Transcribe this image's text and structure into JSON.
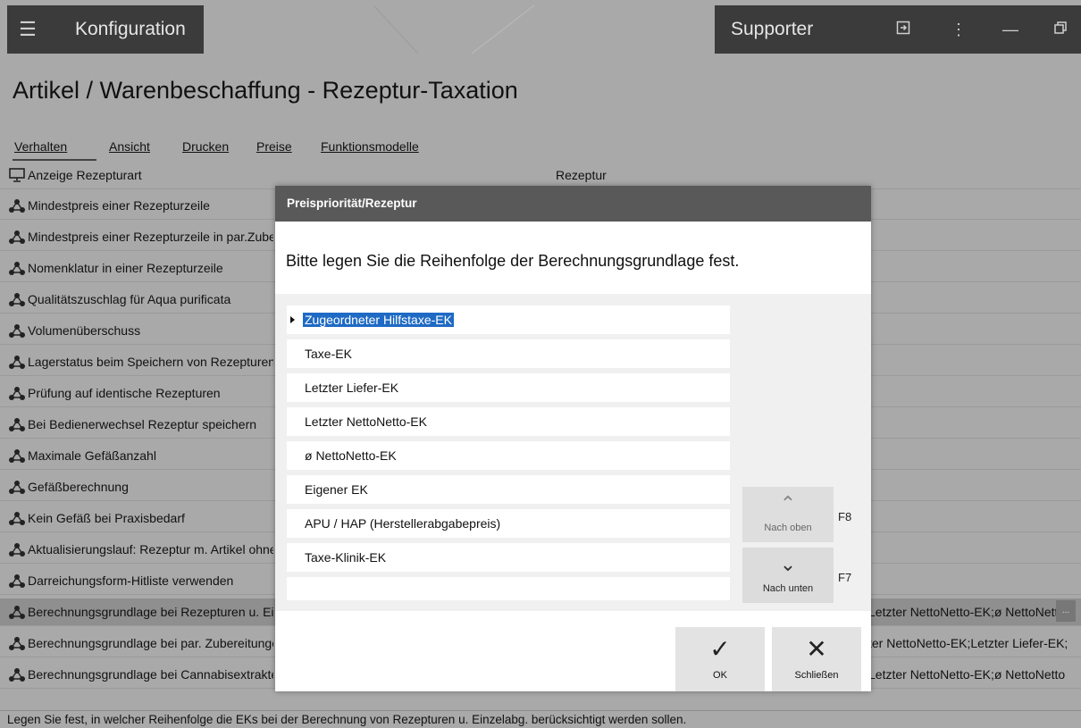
{
  "titlebar": {
    "app_title": "Konfiguration",
    "user": "Supporter",
    "icons": [
      "menu-icon",
      "logout-icon",
      "more-icon",
      "minimize-icon",
      "restore-icon"
    ]
  },
  "page_title": "Artikel / Warenbeschaffung - Rezeptur-Taxation",
  "tabs": [
    "Verhalten",
    "Ansicht",
    "Drucken",
    "Preise",
    "Funktionsmodelle"
  ],
  "rows": [
    {
      "label": "Anzeige Rezepturart",
      "value": "Rezeptur",
      "value_right": ""
    },
    {
      "label": "Mindestpreis einer Rezepturzeile",
      "value": "",
      "value_right": ""
    },
    {
      "label": "Mindestpreis einer Rezepturzeile in par.Zubereitungen",
      "value": "",
      "value_right": ""
    },
    {
      "label": "Nomenklatur in einer Rezepturzeile",
      "value": "",
      "value_right": ""
    },
    {
      "label": "Qualitätszuschlag für Aqua purificata",
      "value": "",
      "value_right": ""
    },
    {
      "label": "Volumenüberschuss",
      "value": "",
      "value_right": ""
    },
    {
      "label": "Lagerstatus beim Speichern von Rezepturen",
      "value": "",
      "value_right": ""
    },
    {
      "label": "Prüfung auf identische Rezepturen",
      "value": "",
      "value_right": ""
    },
    {
      "label": "Bei Bedienerwechsel Rezeptur speichern",
      "value": "",
      "value_right": ""
    },
    {
      "label": "Maximale Gefäßanzahl",
      "value": "",
      "value_right": ""
    },
    {
      "label": "Gefäßberechnung",
      "value": "",
      "value_right": ""
    },
    {
      "label": "Kein Gefäß bei Praxisbedarf",
      "value": "",
      "value_right": ""
    },
    {
      "label": "Aktualisierungslauf: Rezeptur m. Artikel ohne",
      "value": "",
      "value_right": ""
    },
    {
      "label": "Darreichungsform-Hitliste verwenden",
      "value": "",
      "value_right": ""
    },
    {
      "label": "Berechnungsgrundlage bei Rezepturen u. Einzelabg.",
      "value": "",
      "value_right": "Letzter NettoNetto-EK;ø NettoNetto"
    },
    {
      "label": "Berechnungsgrundlage bei par. Zubereitungen",
      "value": "",
      "value_right": "ter NettoNetto-EK;Letzter Liefer-EK;"
    },
    {
      "label": "Berechnungsgrundlage bei Cannabisextrakten",
      "value": "",
      "value_right": "Letzter NettoNetto-EK;ø NettoNetto"
    }
  ],
  "ellipsis": "...",
  "status": "Legen Sie fest, in welcher Reihenfolge die EKs bei der Berechnung von Rezepturen u. Einzelabg. berücksichtigt werden sollen.",
  "dialog": {
    "title": "Preispriorität/Rezeptur",
    "instruction": "Bitte legen Sie die Reihenfolge der Berechnungsgrundlage fest.",
    "items": [
      "Zugeordneter Hilfstaxe-EK",
      "Taxe-EK",
      "Letzter Liefer-EK",
      "Letzter NettoNetto-EK",
      "ø NettoNetto-EK",
      "Eigener EK",
      "APU / HAP (Herstellerabgabepreis)",
      "Taxe-Klinik-EK"
    ],
    "up_label": "Nach oben",
    "up_key": "F8",
    "down_label": "Nach unten",
    "down_key": "F7",
    "ok_label": "OK",
    "close_label": "Schließen"
  }
}
